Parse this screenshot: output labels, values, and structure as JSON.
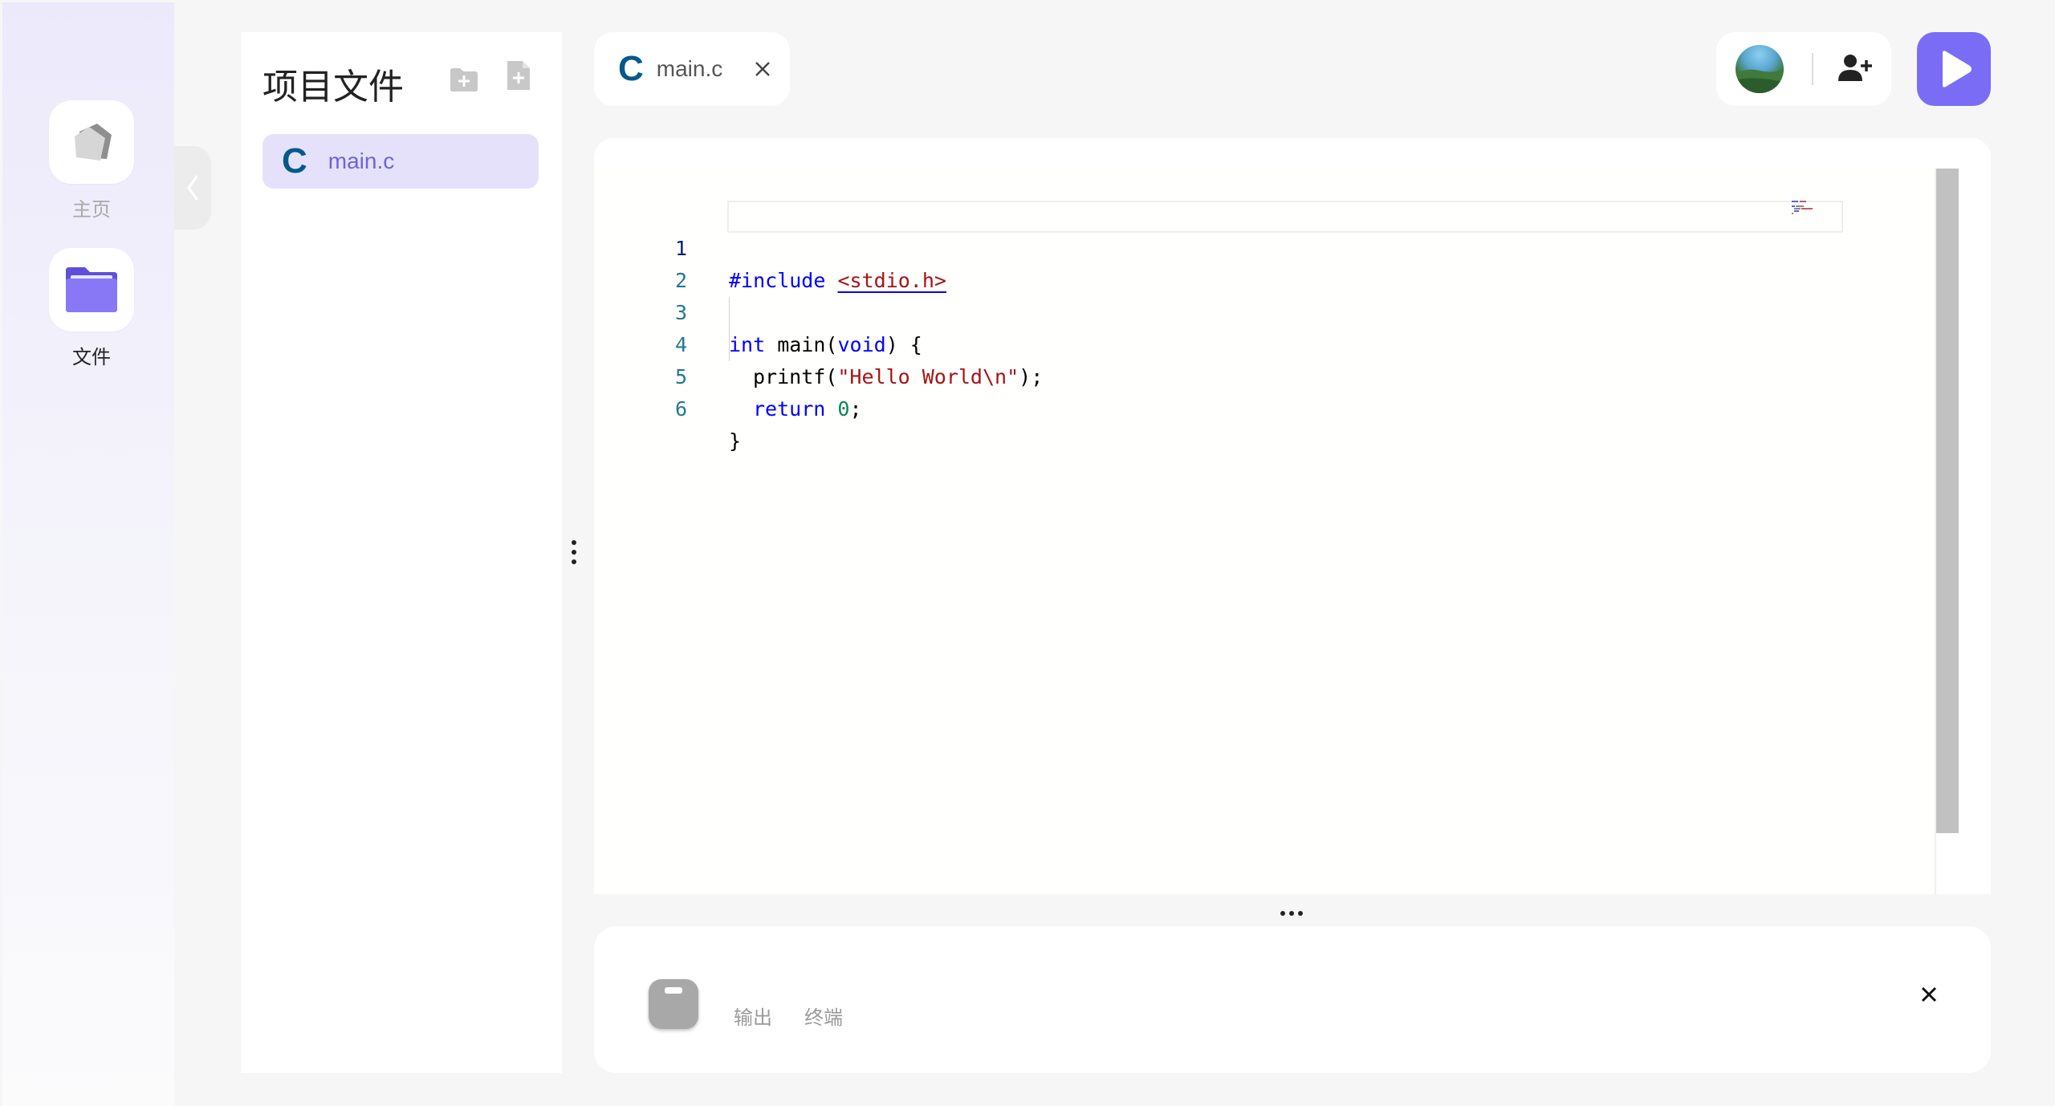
{
  "sidebar": {
    "items": [
      {
        "label": "主页",
        "icon": "home-icon",
        "color": "#a8a8a8"
      },
      {
        "label": "文件",
        "icon": "folder-icon",
        "color": "#222222"
      }
    ]
  },
  "files_panel": {
    "title": "项目文件",
    "tools": [
      "new-folder-icon",
      "new-file-icon"
    ],
    "files": [
      {
        "icon": "C",
        "name": "main.c"
      }
    ]
  },
  "editor_tabs": [
    {
      "icon": "C",
      "name": "main.c"
    }
  ],
  "editor": {
    "language": "c",
    "active_line": 1,
    "line_numbers": [
      "1",
      "2",
      "3",
      "4",
      "5",
      "6"
    ],
    "code_tokens": {
      "l1_directive": "#include",
      "l1_header": "<stdio.h>",
      "l3_type": "int",
      "l3_name": " main(",
      "l3_param": "void",
      "l3_tail": ") {",
      "l4_call": "printf(",
      "l4_str": "\"Hello World\\n\"",
      "l4_tail": ");",
      "l5_kw": "return",
      "l5_num": "0",
      "l5_tail": ";",
      "l6_brace": "}"
    }
  },
  "bottom_panel": {
    "tabs": [
      "输出",
      "终端"
    ]
  },
  "colors": {
    "accent": "#7b6cf6",
    "selected_file_bg": "#e5e1fb",
    "c_logo": "#03598c",
    "keyword": "#0000ff",
    "string": "#a31515",
    "number": "#098658",
    "line_number": "#237893"
  }
}
